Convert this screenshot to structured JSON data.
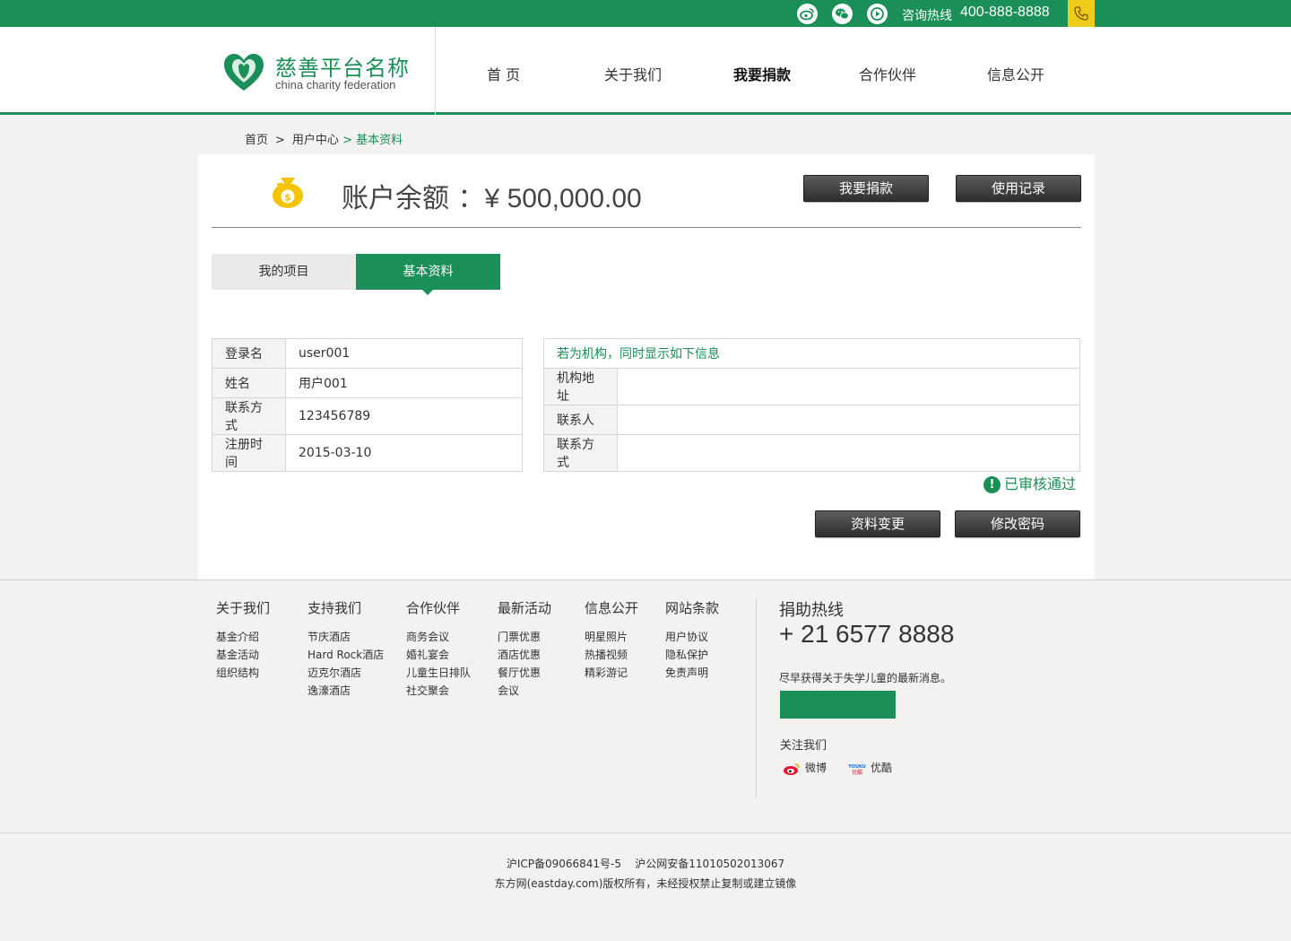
{
  "topbar": {
    "hotline_label": "咨询热线",
    "hotline_number": "400-888-8888",
    "icons": [
      "weibo-icon",
      "wechat-icon",
      "video-icon",
      "phone-icon"
    ]
  },
  "header": {
    "logo_cn": "慈善平台名称",
    "logo_en": "china charity federation",
    "nav": [
      "首 页",
      "关于我们",
      "我要捐款",
      "合作伙伴",
      "信息公开"
    ],
    "active_nav": "我要捐款"
  },
  "breadcrumb": {
    "items": [
      "首页",
      "用户中心",
      "基本资料"
    ],
    "separator": ">"
  },
  "account": {
    "balance_label": "账户余额 ：",
    "balance_value": "¥ 500,000.00",
    "donate_button": "我要捐款",
    "records_button": "使用记录"
  },
  "tabs": {
    "my_projects": "我的项目",
    "basic_info": "基本资料",
    "active": "基本资料"
  },
  "user_info": {
    "rows": [
      {
        "label": "登录名",
        "value": "user001"
      },
      {
        "label": "姓名",
        "value": "用户001"
      },
      {
        "label": "联系方式",
        "value": "123456789"
      },
      {
        "label": "注册时间",
        "value": "2015-03-10"
      }
    ]
  },
  "org_info": {
    "heading": "若为机构，同时显示如下信息",
    "rows": [
      {
        "label": "机构地址",
        "value": ""
      },
      {
        "label": "联系人",
        "value": ""
      },
      {
        "label": "联系方式",
        "value": ""
      }
    ]
  },
  "status": {
    "text": "已审核通过",
    "icon": "!"
  },
  "actions": {
    "edit_profile": "资料变更",
    "change_password": "修改密码"
  },
  "footer": {
    "columns": [
      {
        "title": "关于我们",
        "links": [
          "基金介绍",
          "基金活动",
          "组织结构"
        ]
      },
      {
        "title": "支持我们",
        "links": [
          "节庆酒店",
          "Hard Rock酒店",
          "迈克尔酒店",
          "逸濠酒店"
        ]
      },
      {
        "title": "合作伙伴",
        "links": [
          "商务会议",
          "婚礼宴会",
          "儿童生日排队",
          "社交聚会"
        ]
      },
      {
        "title": "最新活动",
        "links": [
          "门票优惠",
          "酒店优惠",
          "餐厅优惠",
          "会议"
        ]
      },
      {
        "title": "信息公开",
        "links": [
          "明星照片",
          "热播视频",
          "精彩游记"
        ]
      },
      {
        "title": "网站条款",
        "links": [
          "用户协议",
          "隐私保护",
          "免责声明"
        ]
      }
    ],
    "hotline_title": "捐助热线",
    "hotline_number": "+ 21 6577 8888",
    "subscribe_text": "尽早获得关于失学儿童的最新消息。",
    "follow_title": "关注我们",
    "social": [
      {
        "name": "微博",
        "icon": "weibo-icon"
      },
      {
        "name": "优酷",
        "icon": "youku-icon",
        "badge": "YOUKU 优酷"
      }
    ]
  },
  "copyright": {
    "line1": "沪ICP备09066841号-5    沪公网安备11010502013067",
    "line2": "东方网(eastday.com)版权所有，未经授权禁止复制或建立镜像"
  },
  "colors": {
    "brand_green": "#1a8f57",
    "hotline_yellow": "#f0cc1a",
    "dark_button": "#3a3a3a"
  }
}
